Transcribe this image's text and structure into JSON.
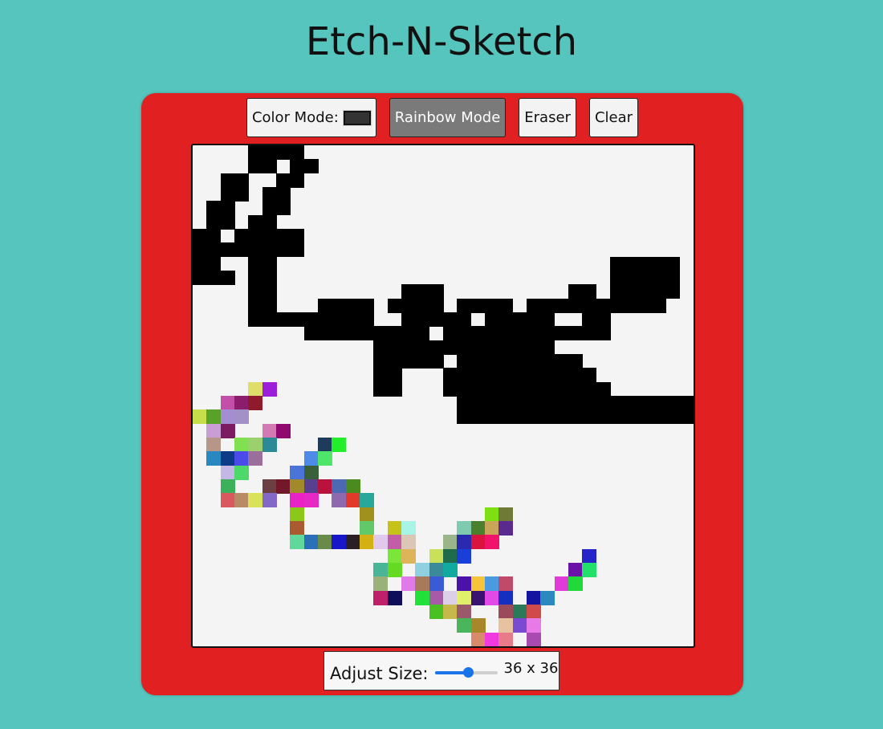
{
  "header": {
    "title": "Etch-N-Sketch"
  },
  "toolbar": {
    "color_mode_label": "Color Mode:",
    "color_mode_swatch": "#333333",
    "rainbow_label": "Rainbow Mode",
    "eraser_label": "Eraser",
    "clear_label": "Clear",
    "active_mode": "rainbow"
  },
  "size_control": {
    "label": "Adjust Size:",
    "value_text": "36 x 36",
    "fraction": 0.55
  },
  "canvas": {
    "background": "#f4f4f4",
    "black_color": "#000000",
    "black_rows": [
      [
        4,
        5,
        6,
        7
      ],
      [
        4,
        5,
        7,
        8
      ],
      [
        2,
        3,
        6,
        7
      ],
      [
        2,
        3,
        5,
        6
      ],
      [
        1,
        2,
        5,
        6
      ],
      [
        1,
        2,
        4,
        5
      ],
      [
        0,
        1,
        3,
        4,
        5,
        6,
        7
      ],
      [
        0,
        1,
        2,
        3,
        4,
        5,
        6,
        7
      ],
      [
        0,
        1,
        4,
        5,
        30,
        31,
        32,
        33,
        34
      ],
      [
        0,
        1,
        2,
        4,
        5,
        30,
        31,
        32,
        33,
        34
      ],
      [
        4,
        5,
        15,
        16,
        17,
        27,
        28,
        30,
        31,
        32,
        33,
        34
      ],
      [
        4,
        5,
        9,
        10,
        11,
        12,
        14,
        15,
        16,
        17,
        19,
        20,
        21,
        22,
        24,
        25,
        26,
        27,
        28,
        29,
        30,
        31,
        32,
        33
      ],
      [
        4,
        5,
        6,
        7,
        8,
        9,
        10,
        11,
        12,
        15,
        16,
        17,
        18,
        19,
        21,
        22,
        23,
        24,
        25,
        28,
        29
      ],
      [
        8,
        9,
        10,
        11,
        12,
        13,
        14,
        15,
        16,
        18,
        19,
        20,
        21,
        22,
        23,
        24,
        25,
        26,
        27,
        28,
        29
      ],
      [
        13,
        14,
        15,
        16,
        17,
        18,
        19,
        20,
        21,
        22,
        23,
        24,
        25
      ],
      [
        13,
        14,
        15,
        16,
        17,
        19,
        20,
        21,
        22,
        23,
        24,
        25,
        26,
        27
      ],
      [
        13,
        14,
        18,
        19,
        20,
        21,
        22,
        23,
        24,
        25,
        26,
        27,
        28
      ],
      [
        13,
        14,
        18,
        19,
        20,
        21,
        22,
        23,
        24,
        25,
        26,
        27,
        28,
        29
      ],
      [
        19,
        20,
        21,
        22,
        23,
        24,
        25,
        26,
        27,
        28,
        29,
        30,
        31,
        32,
        33,
        34,
        35
      ],
      [
        19,
        20,
        21,
        22,
        23,
        24,
        25,
        26,
        27,
        28,
        29,
        30,
        31,
        32,
        33,
        34,
        35
      ]
    ],
    "rainbow_cells": [
      {
        "r": 17,
        "c": 4,
        "color": "#e0de6a"
      },
      {
        "r": 17,
        "c": 5,
        "color": "#9b1fd8"
      },
      {
        "r": 18,
        "c": 2,
        "color": "#c34fa8"
      },
      {
        "r": 18,
        "c": 3,
        "color": "#8c1d6d"
      },
      {
        "r": 18,
        "c": 4,
        "color": "#8e1a2b"
      },
      {
        "r": 19,
        "c": 0,
        "color": "#c6de4a"
      },
      {
        "r": 19,
        "c": 1,
        "color": "#5aa12a"
      },
      {
        "r": 19,
        "c": 2,
        "color": "#a48ed1"
      },
      {
        "r": 19,
        "c": 3,
        "color": "#a191c8"
      },
      {
        "r": 20,
        "c": 1,
        "color": "#c99ed6"
      },
      {
        "r": 20,
        "c": 2,
        "color": "#7b1b60"
      },
      {
        "r": 20,
        "c": 5,
        "color": "#d27ab3"
      },
      {
        "r": 20,
        "c": 6,
        "color": "#8f0a6e"
      },
      {
        "r": 21,
        "c": 1,
        "color": "#b59688"
      },
      {
        "r": 21,
        "c": 3,
        "color": "#80e04f"
      },
      {
        "r": 21,
        "c": 4,
        "color": "#9ccf6e"
      },
      {
        "r": 21,
        "c": 5,
        "color": "#2c8a97"
      },
      {
        "r": 21,
        "c": 9,
        "color": "#1e3b5c"
      },
      {
        "r": 21,
        "c": 10,
        "color": "#22ef2a"
      },
      {
        "r": 22,
        "c": 1,
        "color": "#2a88c1"
      },
      {
        "r": 22,
        "c": 2,
        "color": "#0d3b87"
      },
      {
        "r": 22,
        "c": 3,
        "color": "#4b4be9"
      },
      {
        "r": 22,
        "c": 4,
        "color": "#9a6f9b"
      },
      {
        "r": 22,
        "c": 8,
        "color": "#4e8ae8"
      },
      {
        "r": 22,
        "c": 9,
        "color": "#4de56a"
      },
      {
        "r": 23,
        "c": 2,
        "color": "#c3b7e5"
      },
      {
        "r": 23,
        "c": 3,
        "color": "#4fd86a"
      },
      {
        "r": 23,
        "c": 7,
        "color": "#4a74d8"
      },
      {
        "r": 23,
        "c": 8,
        "color": "#3a5f3b"
      },
      {
        "r": 24,
        "c": 2,
        "color": "#3cb05a"
      },
      {
        "r": 24,
        "c": 5,
        "color": "#6b3f44"
      },
      {
        "r": 24,
        "c": 6,
        "color": "#73172b"
      },
      {
        "r": 24,
        "c": 7,
        "color": "#a08a2a"
      },
      {
        "r": 24,
        "c": 8,
        "color": "#574090"
      },
      {
        "r": 24,
        "c": 9,
        "color": "#b8123d"
      },
      {
        "r": 24,
        "c": 10,
        "color": "#4d69b3"
      },
      {
        "r": 24,
        "c": 11,
        "color": "#4b8a1e"
      },
      {
        "r": 25,
        "c": 2,
        "color": "#d9595f"
      },
      {
        "r": 25,
        "c": 3,
        "color": "#b98a66"
      },
      {
        "r": 25,
        "c": 4,
        "color": "#d8e25a"
      },
      {
        "r": 25,
        "c": 5,
        "color": "#8468c8"
      },
      {
        "r": 25,
        "c": 7,
        "color": "#e822c4"
      },
      {
        "r": 25,
        "c": 8,
        "color": "#e629c5"
      },
      {
        "r": 25,
        "c": 10,
        "color": "#8e69b0"
      },
      {
        "r": 25,
        "c": 11,
        "color": "#e23a2a"
      },
      {
        "r": 25,
        "c": 12,
        "color": "#27a89a"
      },
      {
        "r": 26,
        "c": 7,
        "color": "#8cc81a"
      },
      {
        "r": 26,
        "c": 12,
        "color": "#a0901e"
      },
      {
        "r": 26,
        "c": 21,
        "color": "#7ee010"
      },
      {
        "r": 26,
        "c": 22,
        "color": "#6e7a35"
      },
      {
        "r": 27,
        "c": 7,
        "color": "#a95a2e"
      },
      {
        "r": 27,
        "c": 12,
        "color": "#62c96a"
      },
      {
        "r": 27,
        "c": 14,
        "color": "#c6c21a"
      },
      {
        "r": 27,
        "c": 15,
        "color": "#a8f5e6"
      },
      {
        "r": 27,
        "c": 19,
        "color": "#7ecbb0"
      },
      {
        "r": 27,
        "c": 20,
        "color": "#4a7f2e"
      },
      {
        "r": 27,
        "c": 21,
        "color": "#c9a55a"
      },
      {
        "r": 27,
        "c": 22,
        "color": "#5a2a8e"
      },
      {
        "r": 28,
        "c": 7,
        "color": "#5fd89a"
      },
      {
        "r": 28,
        "c": 8,
        "color": "#2a70b8"
      },
      {
        "r": 28,
        "c": 9,
        "color": "#6a8a4a"
      },
      {
        "r": 28,
        "c": 10,
        "color": "#1717c9"
      },
      {
        "r": 28,
        "c": 11,
        "color": "#2a1f24"
      },
      {
        "r": 28,
        "c": 12,
        "color": "#d4b013"
      },
      {
        "r": 28,
        "c": 13,
        "color": "#e0c9ea"
      },
      {
        "r": 28,
        "c": 14,
        "color": "#c35da6"
      },
      {
        "r": 28,
        "c": 15,
        "color": "#dcc7b7"
      },
      {
        "r": 28,
        "c": 18,
        "color": "#9ab58a"
      },
      {
        "r": 28,
        "c": 19,
        "color": "#2a2ab0"
      },
      {
        "r": 28,
        "c": 20,
        "color": "#d9153f"
      },
      {
        "r": 28,
        "c": 21,
        "color": "#f0146a"
      },
      {
        "r": 29,
        "c": 14,
        "color": "#7ae63a"
      },
      {
        "r": 29,
        "c": 15,
        "color": "#ddb45a"
      },
      {
        "r": 29,
        "c": 17,
        "color": "#c9e05a"
      },
      {
        "r": 29,
        "c": 18,
        "color": "#1f6b4a"
      },
      {
        "r": 29,
        "c": 19,
        "color": "#1a3fd9"
      },
      {
        "r": 29,
        "c": 28,
        "color": "#2424c9"
      },
      {
        "r": 30,
        "c": 13,
        "color": "#4ab596"
      },
      {
        "r": 30,
        "c": 14,
        "color": "#66d922"
      },
      {
        "r": 30,
        "c": 16,
        "color": "#8fd0e0"
      },
      {
        "r": 30,
        "c": 17,
        "color": "#3a8a9a"
      },
      {
        "r": 30,
        "c": 18,
        "color": "#12aaa0"
      },
      {
        "r": 30,
        "c": 27,
        "color": "#6a12a8"
      },
      {
        "r": 30,
        "c": 28,
        "color": "#22e06a"
      },
      {
        "r": 31,
        "c": 13,
        "color": "#9ab27a"
      },
      {
        "r": 31,
        "c": 15,
        "color": "#e07ae8"
      },
      {
        "r": 31,
        "c": 16,
        "color": "#a67a5a"
      },
      {
        "r": 31,
        "c": 17,
        "color": "#3a5ad6"
      },
      {
        "r": 31,
        "c": 19,
        "color": "#4a12a8"
      },
      {
        "r": 31,
        "c": 20,
        "color": "#f5c43a"
      },
      {
        "r": 31,
        "c": 21,
        "color": "#4a9ae0"
      },
      {
        "r": 31,
        "c": 22,
        "color": "#c04a6a"
      },
      {
        "r": 31,
        "c": 26,
        "color": "#e03ad9"
      },
      {
        "r": 31,
        "c": 27,
        "color": "#22d93a"
      },
      {
        "r": 32,
        "c": 13,
        "color": "#c0206a"
      },
      {
        "r": 32,
        "c": 14,
        "color": "#0e0e5a"
      },
      {
        "r": 32,
        "c": 16,
        "color": "#22e03a"
      },
      {
        "r": 32,
        "c": 17,
        "color": "#a75aa8"
      },
      {
        "r": 32,
        "c": 18,
        "color": "#dcd0e8"
      },
      {
        "r": 32,
        "c": 19,
        "color": "#e0f06a"
      },
      {
        "r": 32,
        "c": 20,
        "color": "#3a1270"
      },
      {
        "r": 32,
        "c": 21,
        "color": "#e24ae8"
      },
      {
        "r": 32,
        "c": 22,
        "color": "#1530c0"
      },
      {
        "r": 32,
        "c": 24,
        "color": "#1414a0"
      },
      {
        "r": 32,
        "c": 25,
        "color": "#2a8ac0"
      },
      {
        "r": 33,
        "c": 17,
        "color": "#4ac022"
      },
      {
        "r": 33,
        "c": 18,
        "color": "#c6b84a"
      },
      {
        "r": 33,
        "c": 19,
        "color": "#9a5a6a"
      },
      {
        "r": 33,
        "c": 22,
        "color": "#9a4a5a"
      },
      {
        "r": 33,
        "c": 23,
        "color": "#2a7a5a"
      },
      {
        "r": 33,
        "c": 24,
        "color": "#d04a4a"
      },
      {
        "r": 34,
        "c": 19,
        "color": "#4ab55a"
      },
      {
        "r": 34,
        "c": 20,
        "color": "#a8862a"
      },
      {
        "r": 34,
        "c": 22,
        "color": "#e8c2a0"
      },
      {
        "r": 34,
        "c": 23,
        "color": "#7a4ad0"
      },
      {
        "r": 34,
        "c": 24,
        "color": "#e87ae8"
      },
      {
        "r": 35,
        "c": 20,
        "color": "#d98a6a"
      },
      {
        "r": 35,
        "c": 21,
        "color": "#f03ae0"
      },
      {
        "r": 35,
        "c": 22,
        "color": "#e87a8a"
      },
      {
        "r": 35,
        "c": 24,
        "color": "#a84ab0"
      }
    ]
  }
}
